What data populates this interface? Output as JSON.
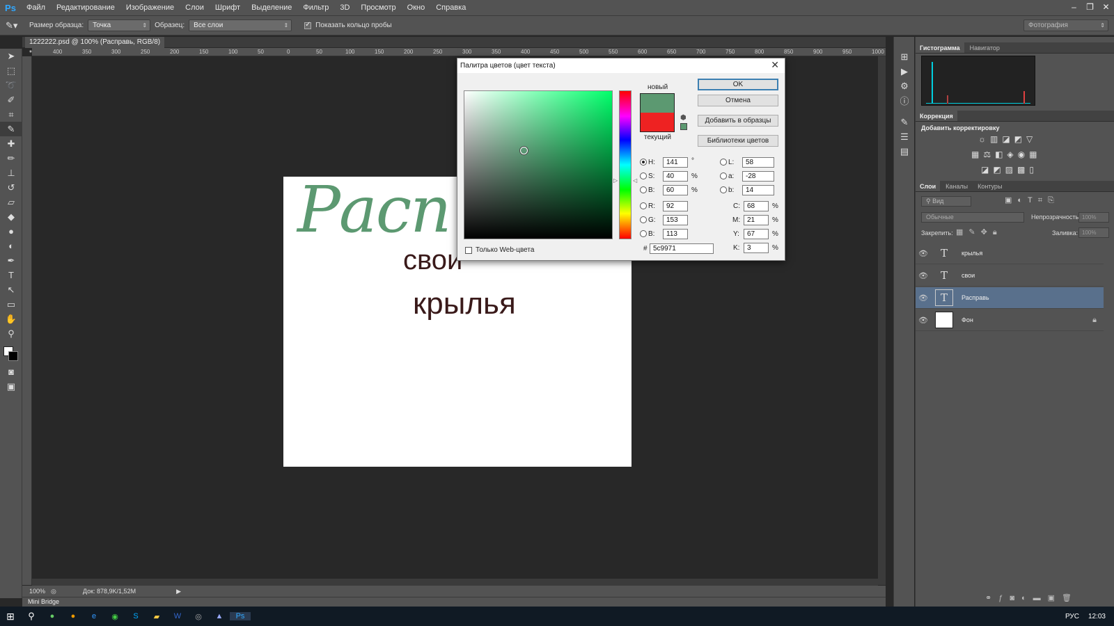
{
  "app_logo": "Ps",
  "menu": [
    "Файл",
    "Редактирование",
    "Изображение",
    "Слои",
    "Шрифт",
    "Выделение",
    "Фильтр",
    "3D",
    "Просмотр",
    "Окно",
    "Справка"
  ],
  "options": {
    "sample_size_label": "Размер образца:",
    "sample_size_value": "Точка",
    "sample_label": "Образец:",
    "sample_value": "Все слои",
    "show_ring_label": "Показать кольцо пробы",
    "workspace_value": "Фотография"
  },
  "document": {
    "tab_title": "1222222.psd @ 100% (Расправь, RGB/8) *",
    "ruler_h": [
      "400",
      "350",
      "300",
      "250",
      "200",
      "150",
      "100",
      "50",
      "0",
      "50",
      "100",
      "150",
      "200",
      "250",
      "300",
      "350",
      "400",
      "450",
      "500",
      "550",
      "600",
      "650",
      "700",
      "750",
      "800",
      "850",
      "900",
      "950",
      "1000"
    ],
    "canvas_texts": {
      "script": "Расп",
      "line1": "свои",
      "line2": "крылья"
    },
    "zoom": "100%",
    "doc_size": "Док: 878,9K/1,52M",
    "mini_bridge": "Mini Bridge"
  },
  "colors": {
    "script_green": "#5c9971",
    "dark_text": "#3a1a1a",
    "current": "#ee2222",
    "new": "#5c9971"
  },
  "dialog": {
    "title": "Палитра цветов (цвет текста)",
    "new_label": "новый",
    "current_label": "текущий",
    "buttons": {
      "ok": "OK",
      "cancel": "Отмена",
      "add_swatch": "Добавить в образцы",
      "libraries": "Библиотеки цветов"
    },
    "web_only": "Только Web-цвета",
    "fields": {
      "H": "141",
      "S": "40",
      "Bv": "60",
      "R": "92",
      "G": "153",
      "Bl": "113",
      "L": "58",
      "a": "-28",
      "b": "14",
      "C": "68",
      "M": "21",
      "Y": "67",
      "K": "3",
      "hex": "5c9971"
    },
    "labels": {
      "H": "H:",
      "S": "S:",
      "Bv": "B:",
      "R": "R:",
      "G": "G:",
      "Bl": "B:",
      "L": "L:",
      "a": "a:",
      "b": "b:",
      "C": "C:",
      "M": "M:",
      "Y": "Y:",
      "K": "K:",
      "hash": "#",
      "deg": "°",
      "pct": "%"
    }
  },
  "panels": {
    "histogram_tabs": [
      "Гистограмма",
      "Навигатор"
    ],
    "correction_tab": "Коррекция",
    "add_correction": "Добавить корректировку",
    "layers_tabs": [
      "Слои",
      "Каналы",
      "Контуры"
    ],
    "filter_kind": "Вид",
    "blend_mode": "Обычные",
    "opacity_label": "Непрозрачность:",
    "opacity_value": "100%",
    "lock_label": "Закрепить:",
    "fill_label": "Заливка:",
    "fill_value": "100%",
    "layers": [
      {
        "name": "крылья",
        "type": "text"
      },
      {
        "name": "свои",
        "type": "text"
      },
      {
        "name": "Расправь",
        "type": "text"
      },
      {
        "name": "Фон",
        "type": "background"
      }
    ]
  },
  "taskbar": {
    "lang": "РУС",
    "time": "12:03"
  }
}
